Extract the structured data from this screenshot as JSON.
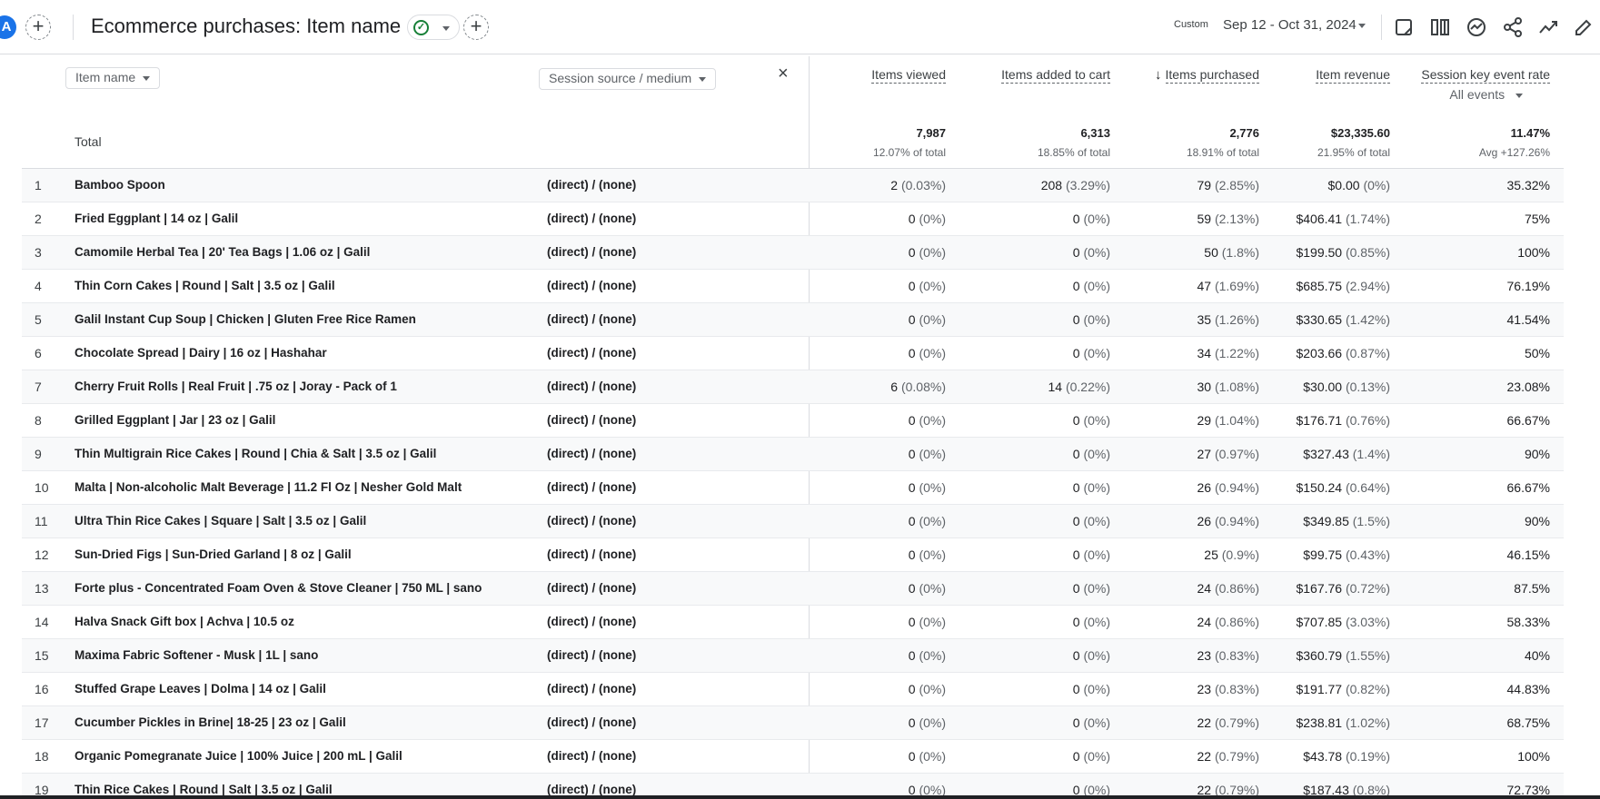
{
  "header": {
    "avatar_letter": "A",
    "title": "Ecommerce purchases: Item name",
    "date_label": "Custom",
    "date_range": "Sep 12 - Oct 31, 2024",
    "icons": [
      "plus-icon",
      "check-circle-icon",
      "plus-icon",
      "compare-icon",
      "columns-icon",
      "insights-icon",
      "share-icon",
      "trend-icon",
      "edit-icon"
    ]
  },
  "table": {
    "dim1": "Item name",
    "dim2": "Session source / medium",
    "close": "×",
    "metrics": [
      "Items viewed",
      "Items added to cart",
      "Items purchased",
      "Item revenue",
      "Session key event rate"
    ],
    "all_events": "All events",
    "total_label": "Total",
    "totals": {
      "viewed": "7,987",
      "viewed_pct": "12.07% of total",
      "cart": "6,313",
      "cart_pct": "18.85% of total",
      "purchased": "2,776",
      "purchased_pct": "18.91% of total",
      "revenue": "$23,335.60",
      "revenue_pct": "21.95% of total",
      "rate": "11.47%",
      "rate_pct": "Avg +127.26%"
    },
    "rows": [
      {
        "idx": "1",
        "item": "Bamboo Spoon",
        "src": "(direct) / (none)",
        "v": "2",
        "vp": "(0.03%)",
        "c": "208",
        "cp": "(3.29%)",
        "p": "79",
        "pp": "(2.85%)",
        "r": "$0.00",
        "rp": "(0%)",
        "k": "35.32%"
      },
      {
        "idx": "2",
        "item": "Fried Eggplant | 14 oz | Galil",
        "src": "(direct) / (none)",
        "v": "0",
        "vp": "(0%)",
        "c": "0",
        "cp": "(0%)",
        "p": "59",
        "pp": "(2.13%)",
        "r": "$406.41",
        "rp": "(1.74%)",
        "k": "75%"
      },
      {
        "idx": "3",
        "item": "Camomile Herbal Tea | 20' Tea Bags | 1.06 oz | Galil",
        "src": "(direct) / (none)",
        "v": "0",
        "vp": "(0%)",
        "c": "0",
        "cp": "(0%)",
        "p": "50",
        "pp": "(1.8%)",
        "r": "$199.50",
        "rp": "(0.85%)",
        "k": "100%"
      },
      {
        "idx": "4",
        "item": "Thin Corn Cakes | Round | Salt | 3.5 oz | Galil",
        "src": "(direct) / (none)",
        "v": "0",
        "vp": "(0%)",
        "c": "0",
        "cp": "(0%)",
        "p": "47",
        "pp": "(1.69%)",
        "r": "$685.75",
        "rp": "(2.94%)",
        "k": "76.19%"
      },
      {
        "idx": "5",
        "item": "Galil Instant Cup Soup | Chicken | Gluten Free Rice Ramen",
        "src": "(direct) / (none)",
        "v": "0",
        "vp": "(0%)",
        "c": "0",
        "cp": "(0%)",
        "p": "35",
        "pp": "(1.26%)",
        "r": "$330.65",
        "rp": "(1.42%)",
        "k": "41.54%"
      },
      {
        "idx": "6",
        "item": "Chocolate Spread | Dairy | 16 oz | Hashahar",
        "src": "(direct) / (none)",
        "v": "0",
        "vp": "(0%)",
        "c": "0",
        "cp": "(0%)",
        "p": "34",
        "pp": "(1.22%)",
        "r": "$203.66",
        "rp": "(0.87%)",
        "k": "50%"
      },
      {
        "idx": "7",
        "item": "Cherry Fruit Rolls | Real Fruit | .75 oz | Joray - Pack of 1",
        "src": "(direct) / (none)",
        "v": "6",
        "vp": "(0.08%)",
        "c": "14",
        "cp": "(0.22%)",
        "p": "30",
        "pp": "(1.08%)",
        "r": "$30.00",
        "rp": "(0.13%)",
        "k": "23.08%"
      },
      {
        "idx": "8",
        "item": "Grilled Eggplant | Jar | 23 oz | Galil",
        "src": "(direct) / (none)",
        "v": "0",
        "vp": "(0%)",
        "c": "0",
        "cp": "(0%)",
        "p": "29",
        "pp": "(1.04%)",
        "r": "$176.71",
        "rp": "(0.76%)",
        "k": "66.67%"
      },
      {
        "idx": "9",
        "item": "Thin Multigrain Rice Cakes | Round | Chia & Salt | 3.5 oz | Galil",
        "src": "(direct) / (none)",
        "v": "0",
        "vp": "(0%)",
        "c": "0",
        "cp": "(0%)",
        "p": "27",
        "pp": "(0.97%)",
        "r": "$327.43",
        "rp": "(1.4%)",
        "k": "90%"
      },
      {
        "idx": "10",
        "item": "Malta | Non-alcoholic Malt Beverage | 11.2 Fl Oz | Nesher Gold Malt",
        "src": "(direct) / (none)",
        "v": "0",
        "vp": "(0%)",
        "c": "0",
        "cp": "(0%)",
        "p": "26",
        "pp": "(0.94%)",
        "r": "$150.24",
        "rp": "(0.64%)",
        "k": "66.67%"
      },
      {
        "idx": "11",
        "item": "Ultra Thin Rice Cakes | Square | Salt | 3.5 oz | Galil",
        "src": "(direct) / (none)",
        "v": "0",
        "vp": "(0%)",
        "c": "0",
        "cp": "(0%)",
        "p": "26",
        "pp": "(0.94%)",
        "r": "$349.85",
        "rp": "(1.5%)",
        "k": "90%"
      },
      {
        "idx": "12",
        "item": "Sun-Dried Figs | Sun-Dried Garland | 8 oz | Galil",
        "src": "(direct) / (none)",
        "v": "0",
        "vp": "(0%)",
        "c": "0",
        "cp": "(0%)",
        "p": "25",
        "pp": "(0.9%)",
        "r": "$99.75",
        "rp": "(0.43%)",
        "k": "46.15%"
      },
      {
        "idx": "13",
        "item": "Forte plus - Concentrated Foam Oven & Stove Cleaner | 750 ML | sano",
        "src": "(direct) / (none)",
        "v": "0",
        "vp": "(0%)",
        "c": "0",
        "cp": "(0%)",
        "p": "24",
        "pp": "(0.86%)",
        "r": "$167.76",
        "rp": "(0.72%)",
        "k": "87.5%"
      },
      {
        "idx": "14",
        "item": "Halva Snack Gift box | Achva | 10.5 oz",
        "src": "(direct) / (none)",
        "v": "0",
        "vp": "(0%)",
        "c": "0",
        "cp": "(0%)",
        "p": "24",
        "pp": "(0.86%)",
        "r": "$707.85",
        "rp": "(3.03%)",
        "k": "58.33%"
      },
      {
        "idx": "15",
        "item": "Maxima Fabric Softener - Musk | 1L | sano",
        "src": "(direct) / (none)",
        "v": "0",
        "vp": "(0%)",
        "c": "0",
        "cp": "(0%)",
        "p": "23",
        "pp": "(0.83%)",
        "r": "$360.79",
        "rp": "(1.55%)",
        "k": "40%"
      },
      {
        "idx": "16",
        "item": "Stuffed Grape Leaves | Dolma | 14 oz | Galil",
        "src": "(direct) / (none)",
        "v": "0",
        "vp": "(0%)",
        "c": "0",
        "cp": "(0%)",
        "p": "23",
        "pp": "(0.83%)",
        "r": "$191.77",
        "rp": "(0.82%)",
        "k": "44.83%"
      },
      {
        "idx": "17",
        "item": "Cucumber Pickles in Brine| 18-25 | 23 oz | Galil",
        "src": "(direct) / (none)",
        "v": "0",
        "vp": "(0%)",
        "c": "0",
        "cp": "(0%)",
        "p": "22",
        "pp": "(0.79%)",
        "r": "$238.81",
        "rp": "(1.02%)",
        "k": "68.75%"
      },
      {
        "idx": "18",
        "item": "Organic Pomegranate Juice | 100% Juice | 200 mL | Galil",
        "src": "(direct) / (none)",
        "v": "0",
        "vp": "(0%)",
        "c": "0",
        "cp": "(0%)",
        "p": "22",
        "pp": "(0.79%)",
        "r": "$43.78",
        "rp": "(0.19%)",
        "k": "100%"
      },
      {
        "idx": "19",
        "item": "Thin Rice Cakes | Round | Salt | 3.5 oz | Galil",
        "src": "(direct) / (none)",
        "v": "0",
        "vp": "(0%)",
        "c": "0",
        "cp": "(0%)",
        "p": "22",
        "pp": "(0.79%)",
        "r": "$187.43",
        "rp": "(0.8%)",
        "k": "72.73%"
      }
    ]
  }
}
